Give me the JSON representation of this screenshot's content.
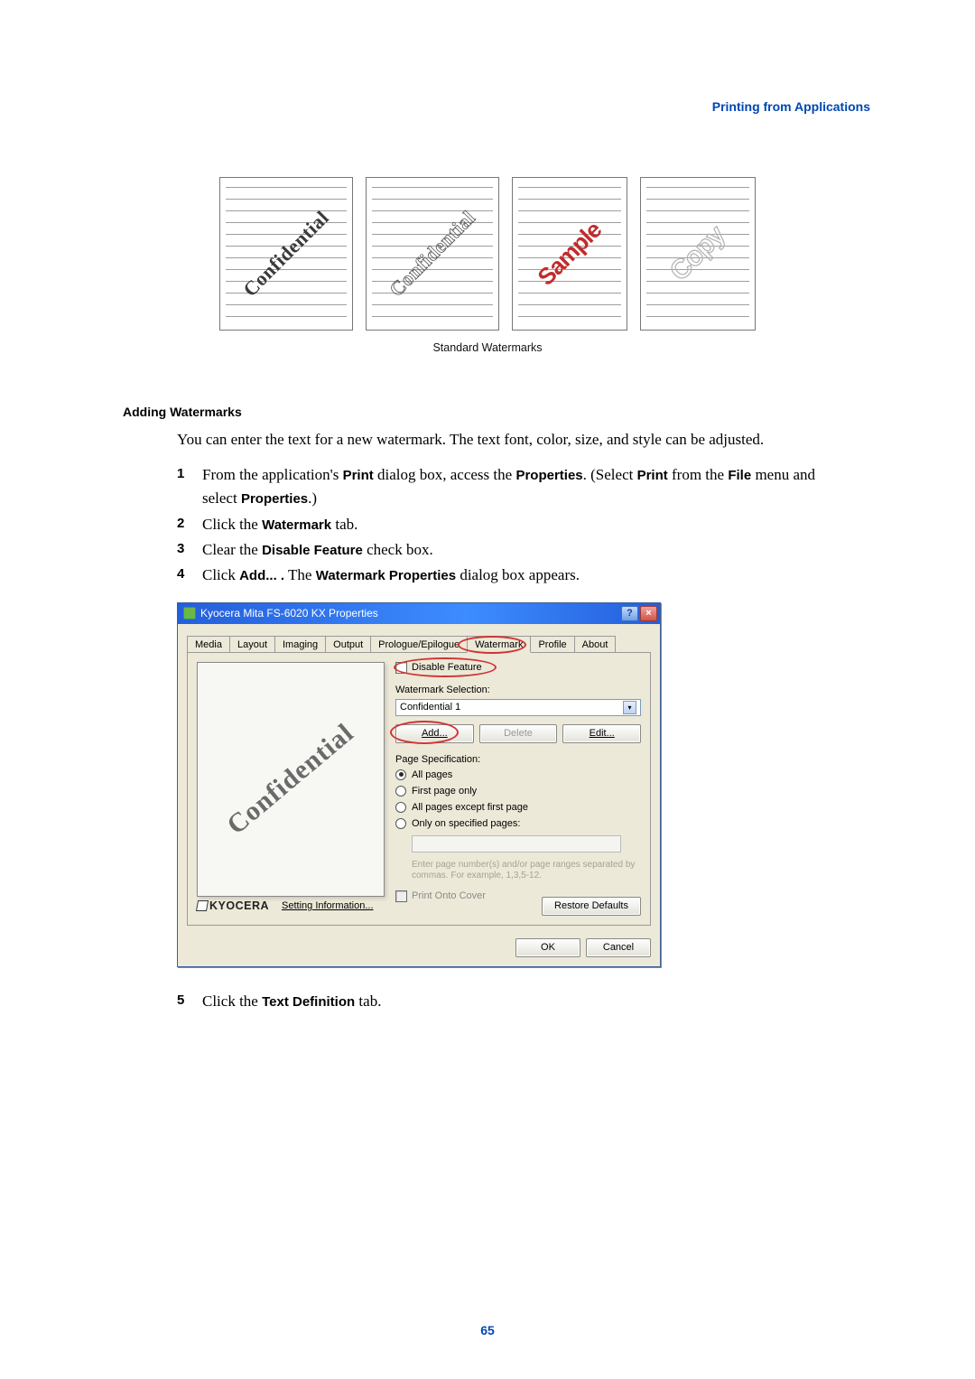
{
  "header": {
    "section_link": "Printing from Applications"
  },
  "watermark_thumbs": {
    "caption": "Standard Watermarks",
    "items": [
      {
        "text": "Confidential",
        "style": "dotted"
      },
      {
        "text": "Confidential",
        "style": "outline1"
      },
      {
        "text": "Sample",
        "style": "sample"
      },
      {
        "text": "Copy",
        "style": "copy"
      }
    ]
  },
  "section": {
    "title": "Adding Watermarks",
    "intro": "You can enter the text for a new watermark. The text font, color, size, and style can be adjusted.",
    "steps": [
      {
        "pre1": "From the application's ",
        "b1": "Print",
        "mid1": " dialog box, access the ",
        "b2": "Properties",
        "mid2": ". (Select ",
        "b3": "Print",
        "mid3": " from the ",
        "b4": "File",
        "mid4": " menu and select ",
        "b5": "Properties",
        "post": ".)"
      },
      {
        "pre1": "Click the ",
        "b1": "Watermark",
        "post": " tab."
      },
      {
        "pre1": "Clear the ",
        "b1": "Disable Feature",
        "post": " check box."
      },
      {
        "pre1": "Click ",
        "b1": "Add... .",
        "mid1": " The ",
        "b2": "Watermark Properties",
        "post": " dialog box appears."
      }
    ],
    "step5": {
      "pre1": "Click the ",
      "b1": "Text Definition",
      "post": " tab."
    }
  },
  "dialog": {
    "title": "Kyocera Mita FS-6020 KX Properties",
    "titlebar": {
      "help": "?",
      "close": "×"
    },
    "tabs": [
      "Media",
      "Layout",
      "Imaging",
      "Output",
      "Prologue/Epilogue",
      "Watermark",
      "Profile",
      "About"
    ],
    "active_tab_index": 5,
    "disable_feature": {
      "label": "Disable Feature",
      "checked": false
    },
    "watermark_selection_label": "Watermark Selection:",
    "selected_watermark": "Confidential 1",
    "buttons": {
      "add": "Add...",
      "delete": "Delete",
      "edit": "Edit..."
    },
    "page_spec_label": "Page Specification:",
    "radios": {
      "all": "All pages",
      "first": "First page only",
      "except_first": "All pages except first page",
      "specified": "Only on specified pages:",
      "hint": "Enter page number(s) and/or page ranges separated by commas. For example, 1,3,5-12."
    },
    "print_onto_label": "Print Onto Cover",
    "brand": "KYOCERA",
    "setting_info": "Setting Information...",
    "restore_defaults": "Restore Defaults",
    "ok": "OK",
    "cancel": "Cancel",
    "preview_text": "Confidential"
  },
  "page_number": "65"
}
